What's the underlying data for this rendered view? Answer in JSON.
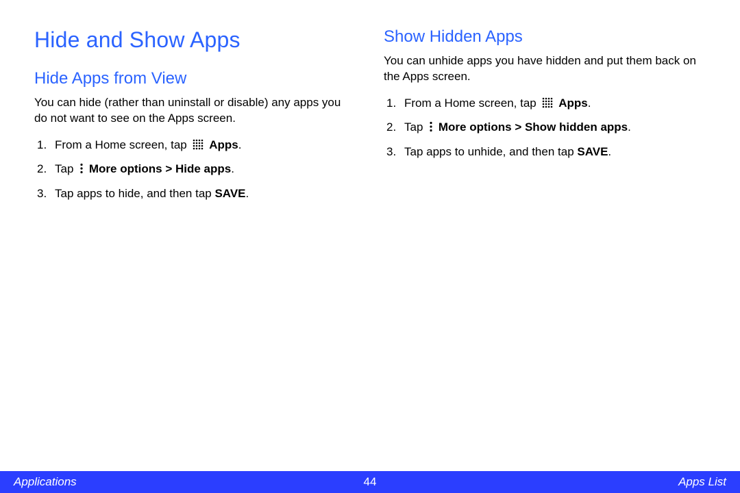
{
  "title": "Hide and Show Apps",
  "left": {
    "heading": "Hide Apps from View",
    "intro": "You can hide (rather than uninstall or disable) any apps you do not want to see on the Apps screen.",
    "steps": [
      {
        "pre": "From a Home screen, tap ",
        "icon": "apps-grid",
        "bold": "Apps",
        "post": "."
      },
      {
        "pre": "Tap ",
        "icon": "more-dots",
        "bold": "More options > Hide apps",
        "post": "."
      },
      {
        "pre": "Tap apps to hide, and then tap ",
        "icon": null,
        "bold": "SAVE",
        "post": "."
      }
    ]
  },
  "right": {
    "heading": "Show Hidden Apps",
    "intro": "You can unhide apps you have hidden and put them back on the Apps screen.",
    "steps": [
      {
        "pre": "From a Home screen, tap ",
        "icon": "apps-grid",
        "bold": "Apps",
        "post": "."
      },
      {
        "pre": "Tap ",
        "icon": "more-dots",
        "bold": "More options > Show hidden apps",
        "post": "."
      },
      {
        "pre": "Tap apps to unhide, and then tap ",
        "icon": null,
        "bold": "SAVE",
        "post": "."
      }
    ]
  },
  "footer": {
    "left": "Applications",
    "page": "44",
    "right": "Apps List"
  },
  "icons": {
    "apps-grid": "apps-grid",
    "more-dots": "more-dots"
  }
}
